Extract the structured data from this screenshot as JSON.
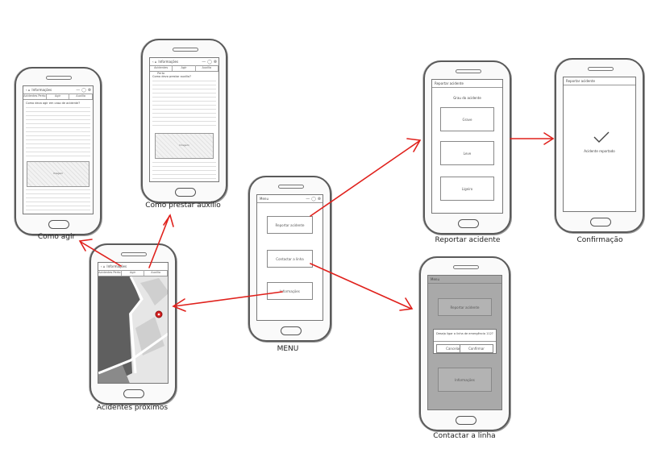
{
  "labels": {
    "como_agir": "Como agir",
    "como_prestar": "Como prestar auxílio",
    "acidentes": "Acidentes próximos",
    "menu": "MENU",
    "reportar": "Reportar acidente",
    "confirmacao": "Confirmação",
    "contactar": "Contactar a linha"
  },
  "info_screen": {
    "title": "Informações",
    "tabs": [
      "Acidentes Perto",
      "Agir",
      "Auxílio"
    ],
    "question_agir": "Como devo agir em caso de acidente?",
    "question_auxilio": "Como devo prestar auxílio?",
    "image_label": "Imagem"
  },
  "menu_screen": {
    "title": "Menu",
    "items": [
      "Reportar acidente",
      "Contactar a linha",
      "Informações"
    ]
  },
  "report_screen": {
    "title": "Reportar acidente",
    "subtitle": "Grau do acidente",
    "options": [
      "Grave",
      "Leve",
      "Ligeiro"
    ]
  },
  "confirm_screen": {
    "title": "Reportar acidente",
    "message": "Acidente reportado"
  },
  "contact_screen": {
    "title": "Menu",
    "item_top": "Reportar acidente",
    "dialog_text": "Deseja ligar a linha de emergência 112?",
    "cancel": "Cancelar",
    "confirm": "Confirmar",
    "item_bottom": "Informações"
  },
  "colors": {
    "arrow": "#e0211c",
    "map_dark": "#5f5f5f",
    "map_light": "#d0d0d0",
    "pin": "#d62020"
  }
}
